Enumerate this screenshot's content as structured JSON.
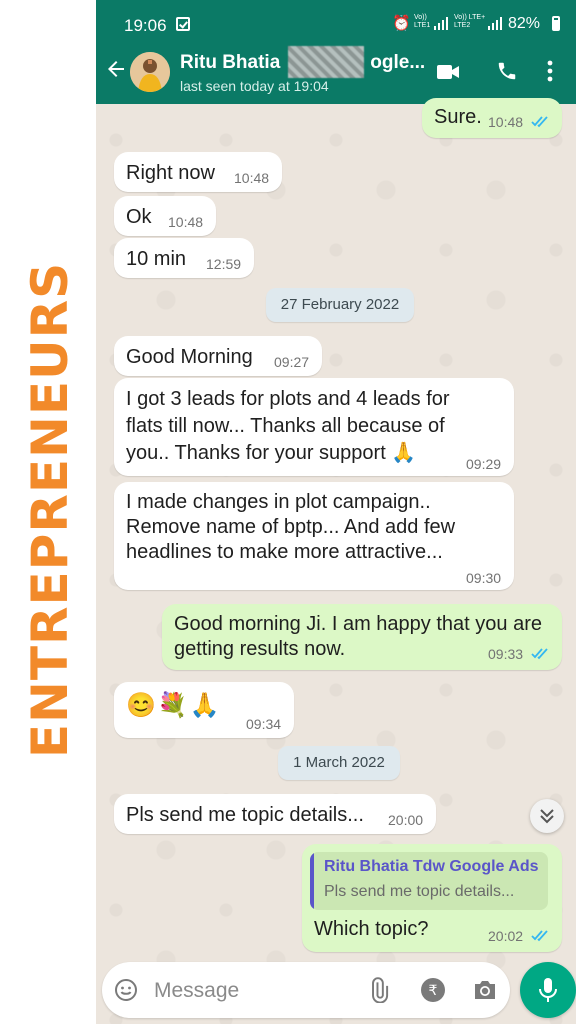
{
  "side_banner": {
    "text": "ENTREPRENEURS"
  },
  "status_bar": {
    "time": "19:06",
    "sim1_label": "Vo))\nLTE1",
    "sim2_label": "Vo))  LTE+\nLTE2",
    "battery": "82%"
  },
  "header": {
    "contact_name": "Ritu Bhatia",
    "contact_name_tail": "ogle...",
    "last_seen": "last seen today at 19:04"
  },
  "messages": [
    {
      "type": "out",
      "text": "Sure.",
      "time": "10:48",
      "read": true
    },
    {
      "type": "in",
      "text": "Right now",
      "time": "10:48"
    },
    {
      "type": "in",
      "text": "Ok",
      "time": "10:48"
    },
    {
      "type": "in",
      "text": "10 min",
      "time": "12:59"
    },
    {
      "type": "date",
      "text": "27 February 2022"
    },
    {
      "type": "in",
      "text": "Good Morning",
      "time": "09:27"
    },
    {
      "type": "in",
      "text": "I got 3 leads for plots and 4 leads for\nflats till now... Thanks all because of\nyou.. Thanks for your support 🙏",
      "time": "09:29"
    },
    {
      "type": "in",
      "text": "I made changes in plot campaign..\nRemove name of bptp... And add few\nheadlines to make more attractive...",
      "time": "09:30"
    },
    {
      "type": "out",
      "text": "Good morning Ji. I am happy that you are\ngetting results now.",
      "time": "09:33",
      "read": true
    },
    {
      "type": "in",
      "text": "😊💐🙏",
      "time": "09:34"
    },
    {
      "type": "date",
      "text": "1 March 2022"
    },
    {
      "type": "in",
      "text": "Pls send me topic details...",
      "time": "20:00"
    },
    {
      "type": "out",
      "quote_name": "Ritu Bhatia Tdw Google Ads",
      "quote_text": "Pls send me topic details...",
      "text": "Which topic?",
      "time": "20:02",
      "read": true
    }
  ],
  "input": {
    "placeholder": "Message"
  },
  "colors": {
    "header": "#0b7a66",
    "outgoing_bubble": "#dcf8c6",
    "incoming_bubble": "#ffffff",
    "read_ticks": "#34b7f1",
    "mic_button": "#00a884",
    "banner_text": "#f28a2a"
  },
  "icons": [
    "back-arrow-icon",
    "video-call-icon",
    "phone-call-icon",
    "more-options-icon",
    "emoji-icon",
    "attach-icon",
    "rupee-payment-icon",
    "camera-icon",
    "mic-icon",
    "scroll-down-icon"
  ]
}
